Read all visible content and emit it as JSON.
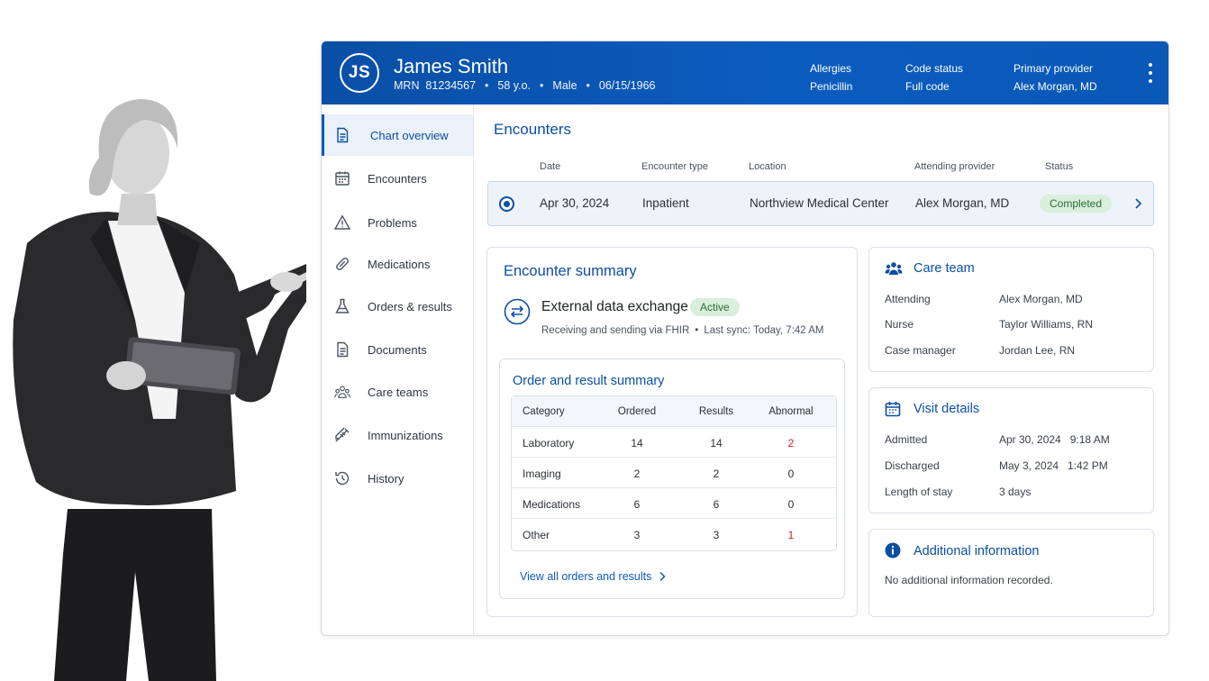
{
  "header": {
    "avatar_initials": "JS",
    "patient_name": "James Smith",
    "mrn": "MRN  81234567",
    "age": "58 y.o.",
    "sex": "Male",
    "dob": "06/15/1966",
    "separator": "•",
    "allergies_label": "Allergies",
    "allergies_value": "Penicillin",
    "code_status_label": "Code status",
    "code_status_value": "Full code",
    "primary_provider_label": "Primary provider",
    "primary_provider_value": "Alex Morgan, MD"
  },
  "sidebar": {
    "items": [
      {
        "label": "Chart overview",
        "icon": "document-icon",
        "active": true
      },
      {
        "label": "Encounters",
        "icon": "calendar-icon"
      },
      {
        "label": "Problems",
        "icon": "warning-icon"
      },
      {
        "label": "Medications",
        "icon": "pill-icon"
      },
      {
        "label": "Orders & results",
        "icon": "flask-icon"
      },
      {
        "label": "Documents",
        "icon": "file-icon"
      },
      {
        "label": "Care teams",
        "icon": "team-icon"
      },
      {
        "label": "Immunizations",
        "icon": "syringe-icon"
      },
      {
        "label": "History",
        "icon": "history-icon"
      }
    ]
  },
  "encounters": {
    "title": "Encounters",
    "columns": {
      "date": "Date",
      "type": "Encounter type",
      "location": "Location",
      "provider": "Attending provider",
      "status": "Status"
    },
    "row": {
      "date": "Apr 30, 2024",
      "type": "Inpatient",
      "location": "Northview Medical Center",
      "provider": "Alex Morgan, MD",
      "status": "Completed"
    }
  },
  "summary": {
    "title": "Encounter summary",
    "exchange_title": "External data exchange",
    "exchange_status": "Active",
    "exchange_desc": "Receiving and sending via FHIR",
    "exchange_sep": "•",
    "exchange_sync": "Last sync: Today, 7:42 AM",
    "orders": {
      "title": "Order and result summary",
      "headers": [
        "Category",
        "Ordered",
        "Results",
        "Abnormal"
      ],
      "rows": [
        {
          "category": "Laboratory",
          "ordered": "14",
          "results": "14",
          "abnormal": "2"
        },
        {
          "category": "Imaging",
          "ordered": "2",
          "results": "2",
          "abnormal": "0"
        },
        {
          "category": "Medications",
          "ordered": "6",
          "results": "6",
          "abnormal": "0"
        },
        {
          "category": "Other",
          "ordered": "3",
          "results": "3",
          "abnormal": "1"
        }
      ],
      "view_all": "View all orders and results"
    }
  },
  "care_team": {
    "title": "Care team",
    "attending_label": "Attending",
    "attending_value": "Alex Morgan, MD",
    "nurse_label": "Nurse",
    "nurse_value": "Taylor Williams, RN",
    "case_manager_label": "Case manager",
    "case_manager_value": "Jordan Lee, RN"
  },
  "visit": {
    "title": "Visit details",
    "admitted_label": "Admitted",
    "admitted_value": "Apr 30, 2024   9:18 AM",
    "discharged_label": "Discharged",
    "discharged_value": "May 3, 2024   1:42 PM",
    "los_label": "Length of stay",
    "los_value": "3 days"
  },
  "additional": {
    "title": "Additional information",
    "text": "No additional information recorded."
  },
  "colors": {
    "brand": "#0b5cbf",
    "accent_text": "#0b4fa3",
    "success_bg": "#d9efdc",
    "abnormal": "#d42020"
  }
}
